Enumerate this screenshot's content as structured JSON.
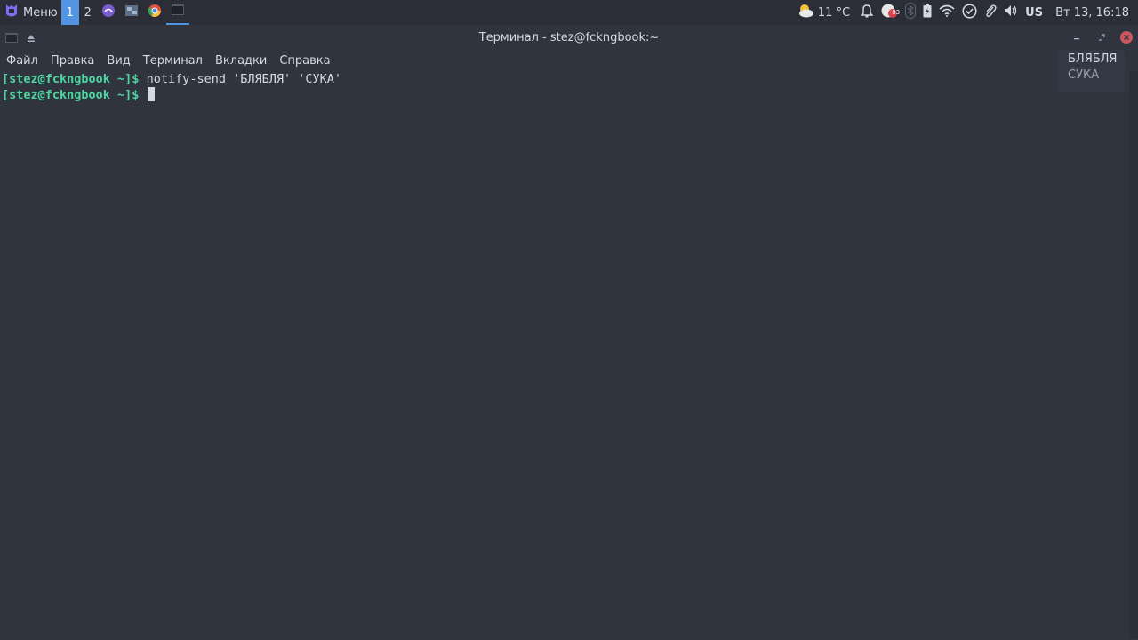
{
  "panel": {
    "menu_label": "Меню",
    "workspaces": [
      "1",
      "2"
    ],
    "active_workspace": "1",
    "weather": "11 °C",
    "updates_badge": "83",
    "keyboard_layout": "US",
    "clock": "Вт 13, 16:18",
    "accent_color": "#5294e2"
  },
  "window": {
    "title": "Терминал - stez@fckngbook:~",
    "menu": [
      "Файл",
      "Правка",
      "Вид",
      "Терминал",
      "Вкладки",
      "Справка"
    ]
  },
  "terminal": {
    "lines": [
      {
        "prompt": "[stez@fckngbook ~]$",
        "command": " notify-send 'БЛЯБЛЯ' 'СУКА'"
      },
      {
        "prompt": "[stez@fckngbook ~]$",
        "command": " "
      }
    ],
    "prompt_color": "#4fd6a0"
  },
  "notification": {
    "summary": "БЛЯБЛЯ",
    "body": "СУКА"
  }
}
